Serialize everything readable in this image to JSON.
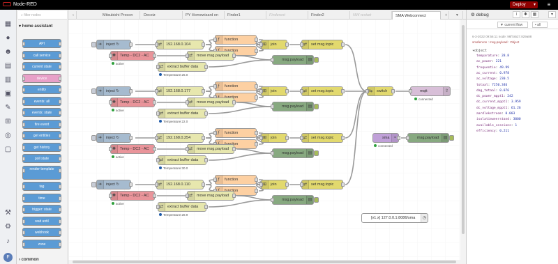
{
  "app": {
    "title": "Node-RED",
    "deploy_label": "Deploy"
  },
  "palette": {
    "search_placeholder": "filter nodes",
    "category": "home assistant",
    "category_bottom": "common",
    "nodes": [
      "API",
      "call service",
      "current state",
      "device",
      "entity",
      "events: all",
      "events: state",
      "fire event",
      "get entities",
      "get history",
      "poll state",
      "render template",
      "tag",
      "time",
      "trigger: state",
      "wait until",
      "webhook",
      "zone"
    ]
  },
  "tabs": [
    "Mitsubishi Procon",
    "Deceiz",
    "PY Homewizard en",
    "Finder1",
    "Finderest",
    "Finder2",
    "NW restart",
    "SMA Webconnect"
  ],
  "flow": {
    "groups": [
      {
        "inject": "inject ↻",
        "ip": "192.168.0.104",
        "func1": "function",
        "func2": "function",
        "temp": "Temp - DC2 - AC",
        "temp_status": "active",
        "move": "move msg.payload",
        "extract": "extract buffer data",
        "extract_status": "Temperature:26.0",
        "join": "join",
        "topic": "set msg.topic",
        "debug": "msg.payload"
      },
      {
        "inject": "inject ↻",
        "ip": "192.168.0.177",
        "func1": "function",
        "func2": "function",
        "temp": "Temp - DC2 - AC",
        "temp_status": "active",
        "move": "move msg.payload",
        "extract": "extract buffer data",
        "extract_status": "Temperature:22.0",
        "join": "join",
        "topic": "set msg.topic",
        "debug": "msg.payload"
      },
      {
        "inject": "inject ↻",
        "ip": "192.168.0.254",
        "func1": "function",
        "func2": "function",
        "temp": "Temp - DC2 - AC",
        "temp_status": "active",
        "move": "move msg.payload",
        "extract": "extract buffer data",
        "extract_status": "Temperature:30.0",
        "join": "join",
        "topic": "set msg.topic",
        "debug": "msg.payload"
      },
      {
        "inject": "inject ↻",
        "ip": "192.168.0.110",
        "func1": "function",
        "func2": "function",
        "temp": "Temp - DC2 - AC",
        "temp_status": "active",
        "move": "move msg.payload",
        "extract": "extract buffer data",
        "extract_status": "Temperature:28.9",
        "join": "join",
        "topic": "set msg.topic",
        "debug": "msg.payload"
      }
    ],
    "switch": "switch",
    "mqtt": "mqtt",
    "mqtt_status": "connected",
    "sma": "sma",
    "sma_status": "connected",
    "sma_debug": "msg.payload",
    "comment": "[v1.x] 127.0.0.1:8086/sma"
  },
  "sidebar": {
    "title": "debug",
    "filter": "current flow",
    "clear": "all",
    "meta": "6-3-2022 09:56:11   node: 96f7a527.829a88",
    "topic": "smafenron : msg.payload : Object",
    "object_label": "▾object",
    "fields": [
      [
        "temparature",
        "28.8"
      ],
      [
        "ac_power",
        "221"
      ],
      [
        "frequentie",
        "49.99"
      ],
      [
        "ac_current",
        "0.978"
      ],
      [
        "ac_voltage",
        "230.5"
      ],
      [
        "totaal",
        "7250.346"
      ],
      [
        "dag_totaal",
        "0.076"
      ],
      [
        "dc_power_mppt1",
        "242"
      ],
      [
        "dc_current_mppt1",
        "3.959"
      ],
      [
        "dc_voltage_mppt1",
        "61.26"
      ],
      [
        "aardlekstroom",
        "0.003"
      ],
      [
        "isolatieweerstand",
        "3000"
      ],
      [
        "available_sessions",
        "1"
      ],
      [
        "efficiency",
        "0.211"
      ]
    ]
  }
}
